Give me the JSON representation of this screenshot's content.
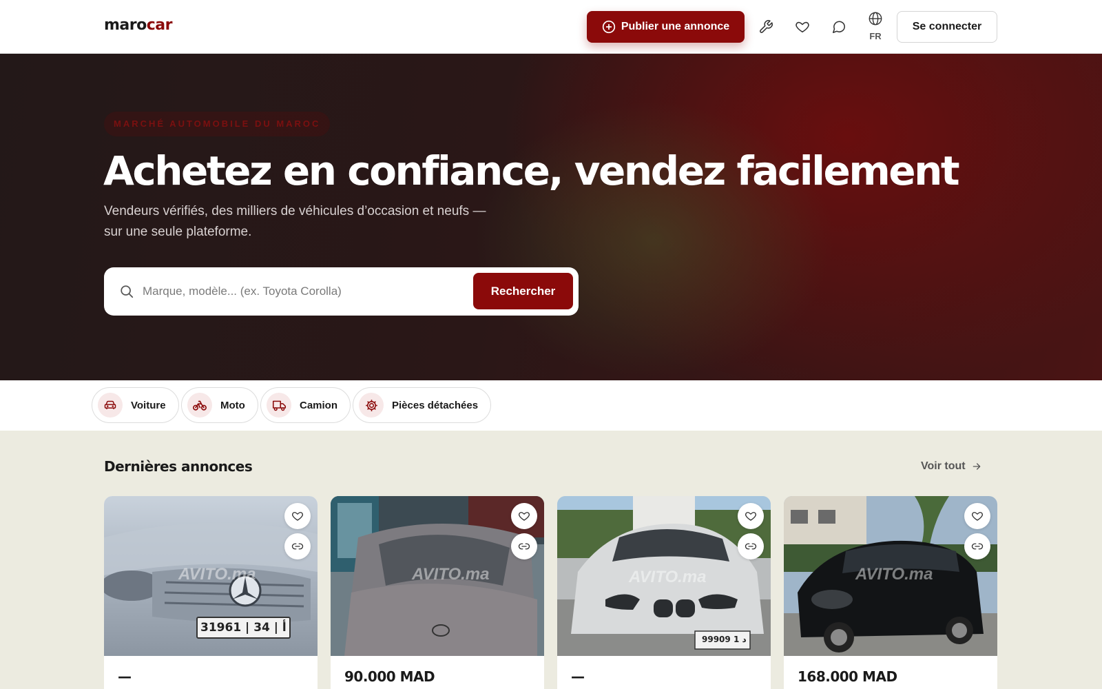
{
  "brand": {
    "logo_part1": "maro",
    "logo_part2": "car",
    "primary_color": "#8b0a0a"
  },
  "header": {
    "publish_label": "Publier une annonce",
    "language": "FR",
    "login_label": "Se connecter",
    "icons": [
      "wrench-icon",
      "heart-icon",
      "chat-icon",
      "globe-icon"
    ]
  },
  "hero": {
    "eyebrow": "MARCHÉ AUTOMOBILE DU MAROC",
    "title": "Achetez en confiance, vendez facilement",
    "subtitle": "Vendeurs vérifiés, des milliers de véhicules d’occasion et neufs — sur une seule plateforme.",
    "search": {
      "placeholder": "Marque, modèle... (ex. Toyota Corolla)",
      "value": "",
      "button_label": "Rechercher"
    }
  },
  "categories": [
    {
      "label": "Voiture",
      "icon": "car-icon"
    },
    {
      "label": "Moto",
      "icon": "motorcycle-icon"
    },
    {
      "label": "Camion",
      "icon": "truck-icon"
    },
    {
      "label": "Pièces détachées",
      "icon": "gear-icon"
    }
  ],
  "listings": {
    "title": "Dernières annonces",
    "see_all_label": "Voir tout",
    "items": [
      {
        "price": "—",
        "plate": "31961 | ﺃ | 34",
        "watermark": "AVITO.ma"
      },
      {
        "price": "90.000 MAD",
        "watermark": "AVITO.ma"
      },
      {
        "price": "—",
        "plate": "99909 ﺩ 1",
        "watermark": "AVITO.ma"
      },
      {
        "price": "168.000 MAD",
        "watermark": "AVITO.ma"
      }
    ]
  }
}
